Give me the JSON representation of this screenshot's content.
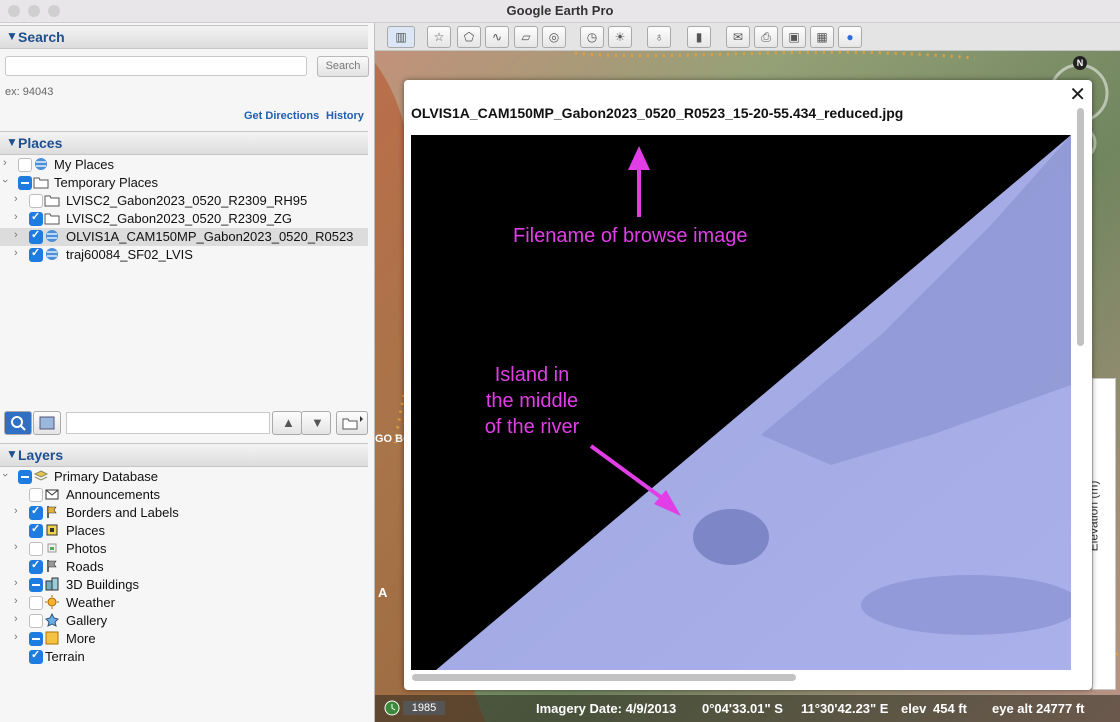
{
  "window": {
    "title": "Google Earth Pro"
  },
  "search": {
    "header": "Search",
    "button": "Search",
    "hint": "ex: 94043",
    "get_directions": "Get Directions",
    "history": "History"
  },
  "places": {
    "header": "Places",
    "items": [
      {
        "label": "My Places"
      },
      {
        "label": "Temporary Places"
      },
      {
        "label": "LVISC2_Gabon2023_0520_R2309_RH95"
      },
      {
        "label": "LVISC2_Gabon2023_0520_R2309_ZG"
      },
      {
        "label": "OLVIS1A_CAM150MP_Gabon2023_0520_R0523"
      },
      {
        "label": "traj60084_SF02_LVIS"
      }
    ]
  },
  "layers": {
    "header": "Layers",
    "items": [
      {
        "label": "Primary Database"
      },
      {
        "label": "Announcements"
      },
      {
        "label": "Borders and Labels"
      },
      {
        "label": "Places"
      },
      {
        "label": "Photos"
      },
      {
        "label": "Roads"
      },
      {
        "label": "3D Buildings"
      },
      {
        "label": "Weather"
      },
      {
        "label": "Gallery"
      },
      {
        "label": "More"
      },
      {
        "label": "Terrain"
      }
    ]
  },
  "popup": {
    "filename": "OLVIS1A_CAM150MP_Gabon2023_0520_R0523_15-20-55.434_reduced.jpg",
    "annotation_filename": "Filename of browse image",
    "annotation_island": [
      "Island in",
      "the middle",
      "of the river"
    ]
  },
  "map": {
    "compass_letter": "N",
    "map_label_left": "GO BO",
    "map_label_a": "A",
    "elevation_label": "Elevation (m)"
  },
  "status": {
    "year": "1985",
    "imagery_date": "Imagery Date: 4/9/2013",
    "lat": "0°04'33.01\" S",
    "lon": "11°30'42.23\" E",
    "elev_label": "elev",
    "elev_value": "454 ft",
    "eye_alt": "eye alt  24777 ft"
  },
  "colors": {
    "annotation": "#e23ee8",
    "accent": "#1e4f8f",
    "checkbox": "#1e7be0"
  }
}
